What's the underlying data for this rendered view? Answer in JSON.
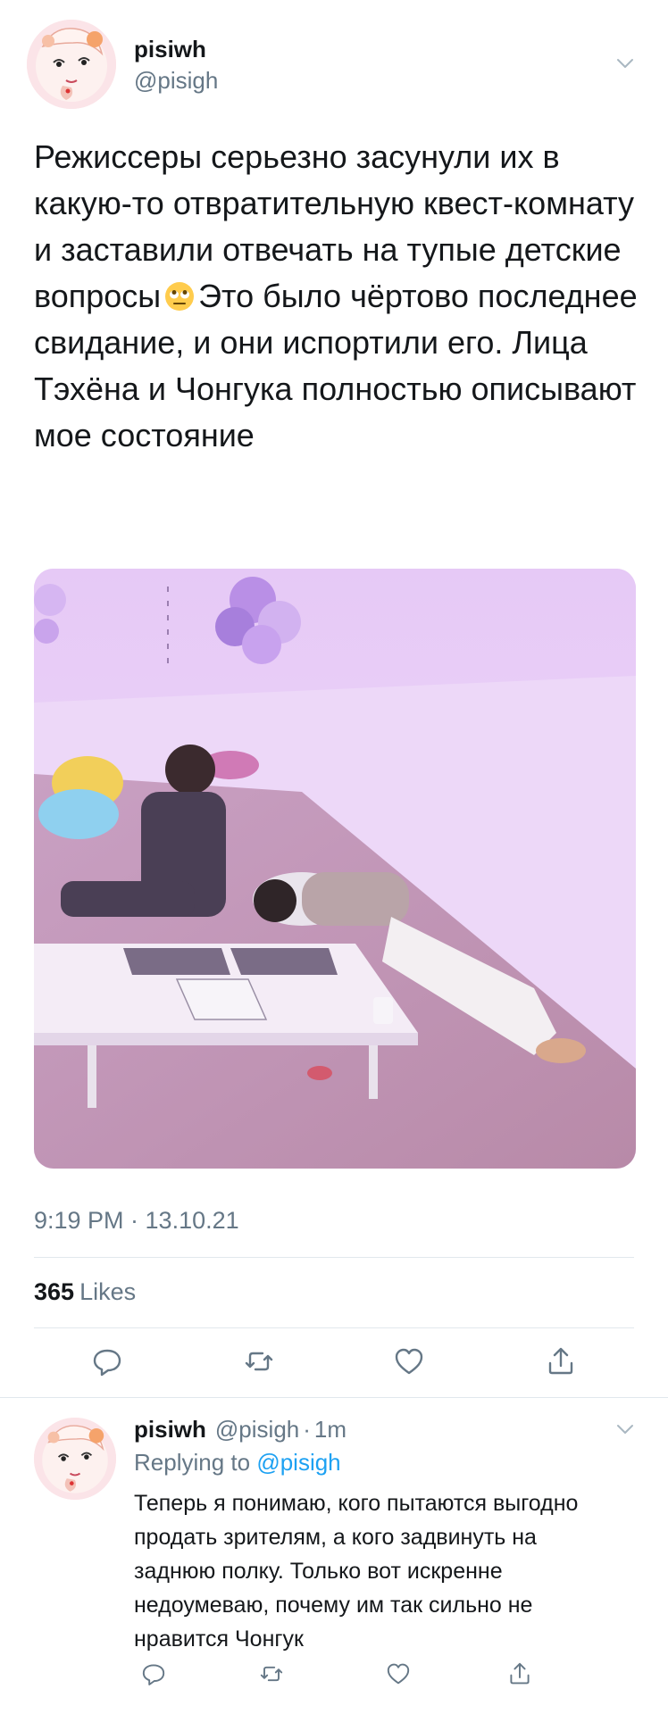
{
  "tweet": {
    "author_name": "pisiwh",
    "author_handle": "@pisigh",
    "avatar_icon": "anime-girl-avatar",
    "text_before_emoji": "Режиссеры серьезно засунули их в какую-то отвратительную квест-комнату и заставили отвечать на тупые детские вопросы",
    "emoji": "eye-roll-emoji",
    "text_after_emoji": "Это было чёртово последнее свидание, и они испортили его. Лица Тэхёна и Чонгука полностью описывают мое состояние",
    "media_icon": "photo-two-people-purple-room",
    "timestamp": "9:19 PM · 13.10.21",
    "likes_count": "365",
    "likes_label": "Likes",
    "actions": [
      "reply-icon",
      "retweet-icon",
      "like-icon",
      "share-icon"
    ]
  },
  "reply": {
    "author_name": "pisiwh",
    "author_handle": "@pisigh",
    "time": "1m",
    "meta_separator": "·",
    "replying_label": "Replying to",
    "replying_to": "@pisigh",
    "text": "Теперь я понимаю, кого пытаются выгодно продать зрителям, а кого задвинуть на заднюю полку. Только вот искренне недоумеваю, почему им так сильно не нравится Чонгук"
  },
  "colors": {
    "text_primary": "#14171a",
    "text_secondary": "#657786",
    "link": "#1da1f2",
    "divider": "#e1e8ed"
  }
}
